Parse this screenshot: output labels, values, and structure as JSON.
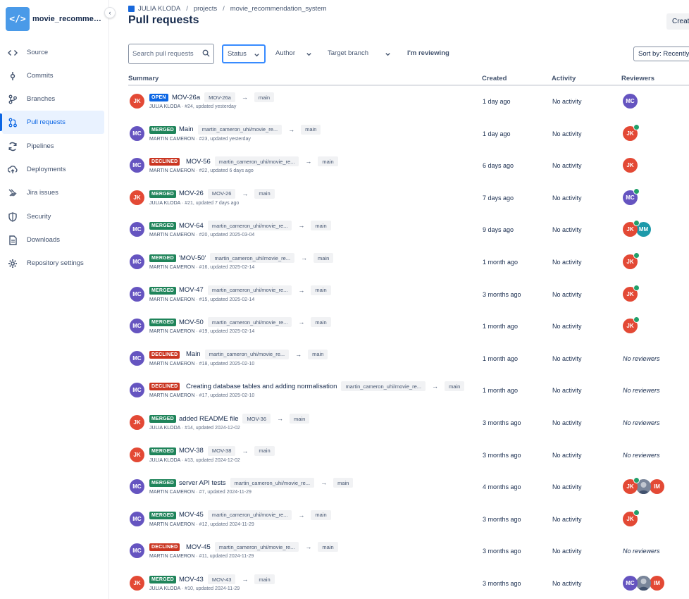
{
  "sidebar": {
    "repo_name": "movie_recommendation_system",
    "repo_logo": "</>",
    "collapse_glyph": "‹",
    "items": [
      {
        "label": "Source",
        "icon": "code-icon"
      },
      {
        "label": "Commits",
        "icon": "commit-icon"
      },
      {
        "label": "Branches",
        "icon": "branch-icon"
      },
      {
        "label": "Pull requests",
        "icon": "pull-request-icon",
        "active": true
      },
      {
        "label": "Pipelines",
        "icon": "pipelines-icon"
      },
      {
        "label": "Deployments",
        "icon": "deployments-icon"
      },
      {
        "label": "Jira issues",
        "icon": "jira-icon"
      },
      {
        "label": "Security",
        "icon": "shield-icon"
      },
      {
        "label": "Downloads",
        "icon": "file-icon"
      },
      {
        "label": "Repository settings",
        "icon": "gear-icon"
      }
    ]
  },
  "breadcrumb": {
    "owner": "JULIA KLODA",
    "sep": "/",
    "project": "projects",
    "repo": "movie_recommendation_system"
  },
  "header": {
    "title": "Pull requests",
    "create_label": "Create"
  },
  "filters": {
    "search_placeholder": "Search pull requests",
    "status": "Status",
    "author": "Author",
    "target_branch": "Target branch",
    "reviewing": "I'm reviewing",
    "sort": "Sort by: Recently updated"
  },
  "table": {
    "columns": {
      "summary": "Summary",
      "created": "Created",
      "activity": "Activity",
      "reviewers": "Reviewers"
    },
    "arrow": "→",
    "rows": [
      {
        "avatar": "JK",
        "status": "OPEN",
        "title": "MOV-26a",
        "source": "MOV-26a",
        "target": "main",
        "author": "JULIA KLODA",
        "meta": "#24, updated yesterday",
        "created": "1 day ago",
        "activity": "No activity",
        "reviewers": [
          {
            "initials": "MC",
            "approved": false
          }
        ],
        "no_reviewers": ""
      },
      {
        "avatar": "MC",
        "status": "MERGED",
        "title": "Main",
        "source": "martin_cameron_uhi/movie_re...",
        "target": "main",
        "author": "MARTIN CAMERON",
        "meta": "#23, updated yesterday",
        "created": "1 day ago",
        "activity": "No activity",
        "reviewers": [
          {
            "initials": "JK",
            "approved": true
          }
        ],
        "no_reviewers": ""
      },
      {
        "avatar": "MC",
        "status": "DECLINED",
        "title": "MOV-56",
        "source": "martin_cameron_uhi/movie_re...",
        "target": "main",
        "author": "MARTIN CAMERON",
        "meta": "#22, updated 6 days ago",
        "created": "6 days ago",
        "activity": "No activity",
        "reviewers": [
          {
            "initials": "JK",
            "approved": false
          }
        ],
        "no_reviewers": ""
      },
      {
        "avatar": "JK",
        "status": "MERGED",
        "title": "MOV-26",
        "source": "MOV-26",
        "target": "main",
        "author": "JULIA KLODA",
        "meta": "#21, updated 7 days ago",
        "created": "7 days ago",
        "activity": "No activity",
        "reviewers": [
          {
            "initials": "MC",
            "approved": true
          }
        ],
        "no_reviewers": ""
      },
      {
        "avatar": "MC",
        "status": "MERGED",
        "title": "MOV-64",
        "source": "martin_cameron_uhi/movie_re...",
        "target": "main",
        "author": "MARTIN CAMERON",
        "meta": "#20, updated 2025-03-04",
        "created": "9 days ago",
        "activity": "No activity",
        "reviewers": [
          {
            "initials": "JK",
            "approved": true
          },
          {
            "initials": "MM",
            "approved": false
          }
        ],
        "no_reviewers": ""
      },
      {
        "avatar": "MC",
        "status": "MERGED",
        "title": "'MOV-50'",
        "source": "martin_cameron_uhi/movie_re...",
        "target": "main",
        "author": "MARTIN CAMERON",
        "meta": "#16, updated 2025-02-14",
        "created": "1 month ago",
        "activity": "No activity",
        "reviewers": [
          {
            "initials": "JK",
            "approved": true
          }
        ],
        "no_reviewers": ""
      },
      {
        "avatar": "MC",
        "status": "MERGED",
        "title": "MOV-47",
        "source": "martin_cameron_uhi/movie_re...",
        "target": "main",
        "author": "MARTIN CAMERON",
        "meta": "#15, updated 2025-02-14",
        "created": "3 months ago",
        "activity": "No activity",
        "reviewers": [
          {
            "initials": "JK",
            "approved": true
          }
        ],
        "no_reviewers": ""
      },
      {
        "avatar": "MC",
        "status": "MERGED",
        "title": "MOV-50",
        "source": "martin_cameron_uhi/movie_re...",
        "target": "main",
        "author": "MARTIN CAMERON",
        "meta": "#19, updated 2025-02-14",
        "created": "1 month ago",
        "activity": "No activity",
        "reviewers": [
          {
            "initials": "JK",
            "approved": true
          }
        ],
        "no_reviewers": ""
      },
      {
        "avatar": "MC",
        "status": "DECLINED",
        "title": "Main",
        "source": "martin_cameron_uhi/movie_re...",
        "target": "main",
        "author": "MARTIN CAMERON",
        "meta": "#18, updated 2025-02-10",
        "created": "1 month ago",
        "activity": "No activity",
        "reviewers": [],
        "no_reviewers": "No reviewers"
      },
      {
        "avatar": "MC",
        "status": "DECLINED",
        "title": "Creating database tables and adding normalisation",
        "source": "martin_cameron_uhi/movie_re...",
        "target": "main",
        "author": "MARTIN CAMERON",
        "meta": "#17, updated 2025-02-10",
        "created": "1 month ago",
        "activity": "No activity",
        "reviewers": [],
        "no_reviewers": "No reviewers"
      },
      {
        "avatar": "JK",
        "status": "MERGED",
        "title": "added README file",
        "source": "MOV-36",
        "target": "main",
        "author": "JULIA KLODA",
        "meta": "#14, updated 2024-12-02",
        "created": "3 months ago",
        "activity": "No activity",
        "reviewers": [],
        "no_reviewers": "No reviewers"
      },
      {
        "avatar": "JK",
        "status": "MERGED",
        "title": "MOV-38",
        "source": "MOV-38",
        "target": "main",
        "author": "JULIA KLODA",
        "meta": "#13, updated 2024-12-02",
        "created": "3 months ago",
        "activity": "No activity",
        "reviewers": [],
        "no_reviewers": "No reviewers"
      },
      {
        "avatar": "MC",
        "status": "MERGED",
        "title": "server API tests",
        "source": "martin_cameron_uhi/movie_re...",
        "target": "main",
        "author": "MARTIN CAMERON",
        "meta": "#7, updated 2024-11-29",
        "created": "4 months ago",
        "activity": "No activity",
        "reviewers": [
          {
            "initials": "JK",
            "approved": true
          },
          {
            "initials": "",
            "approved": false,
            "photo": true
          },
          {
            "initials": "IM",
            "approved": false
          }
        ],
        "no_reviewers": ""
      },
      {
        "avatar": "MC",
        "status": "MERGED",
        "title": "MOV-45",
        "source": "martin_cameron_uhi/movie_re...",
        "target": "main",
        "author": "MARTIN CAMERON",
        "meta": "#12, updated 2024-11-29",
        "created": "3 months ago",
        "activity": "No activity",
        "reviewers": [
          {
            "initials": "JK",
            "approved": true
          }
        ],
        "no_reviewers": ""
      },
      {
        "avatar": "MC",
        "status": "DECLINED",
        "title": "MOV-45",
        "source": "martin_cameron_uhi/movie_re...",
        "target": "main",
        "author": "MARTIN CAMERON",
        "meta": "#11, updated 2024-11-29",
        "created": "3 months ago",
        "activity": "No activity",
        "reviewers": [],
        "no_reviewers": "No reviewers"
      },
      {
        "avatar": "JK",
        "status": "MERGED",
        "title": "MOV-43",
        "source": "MOV-43",
        "target": "main",
        "author": "JULIA KLODA",
        "meta": "#10, updated 2024-11-29",
        "created": "3 months ago",
        "activity": "No activity",
        "reviewers": [
          {
            "initials": "MC",
            "approved": false
          },
          {
            "initials": "",
            "approved": false,
            "photo": true
          },
          {
            "initials": "IM",
            "approved": false
          }
        ],
        "no_reviewers": ""
      }
    ]
  },
  "colors": {
    "OPEN": "#0c66e4",
    "MERGED": "#1f845a",
    "DECLINED": "#ca3521",
    "JK": "#e34935",
    "MC": "#6554c0",
    "MM": "#1d9aaa",
    "IM": "#e34935"
  }
}
